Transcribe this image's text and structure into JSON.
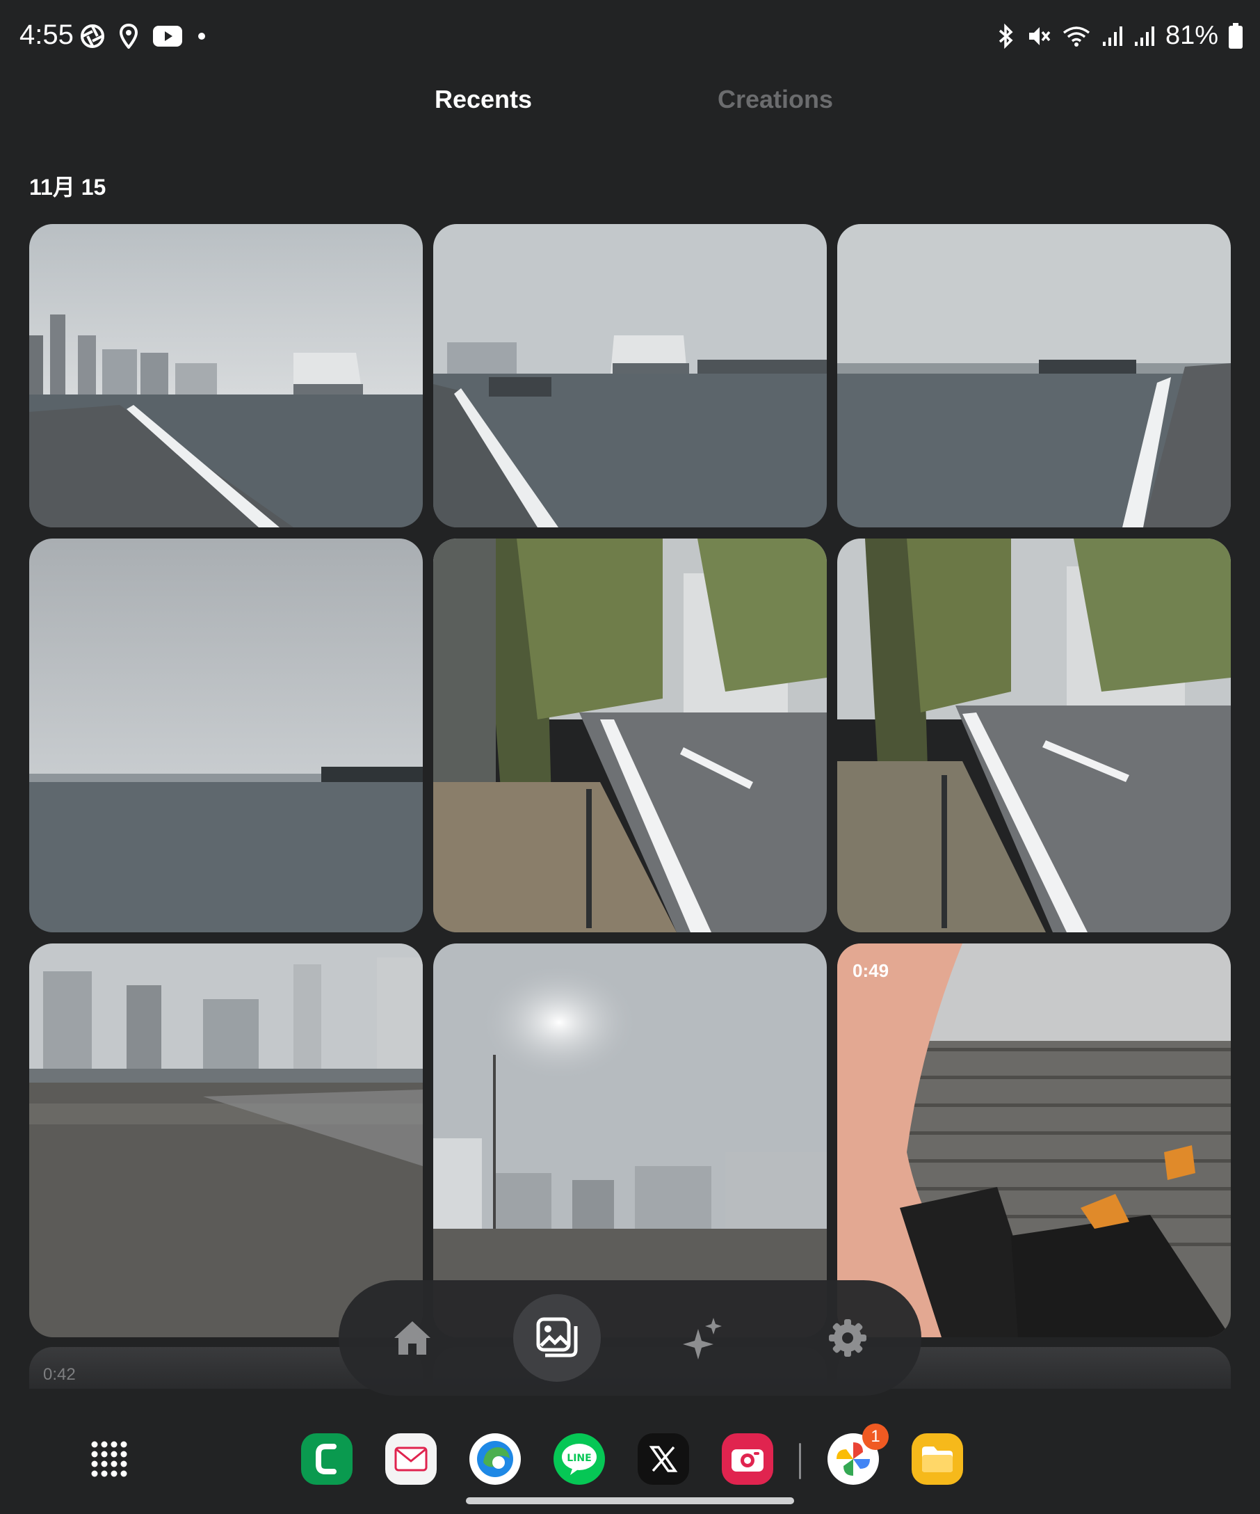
{
  "status": {
    "time": "4:55",
    "battery_pct": "81%"
  },
  "tabs": [
    {
      "label": "Recents",
      "active": true
    },
    {
      "label": "Creations",
      "active": false
    }
  ],
  "date_header": "11月 15",
  "photos": [
    {
      "kind": "photo",
      "scene": "harbor-railing-left"
    },
    {
      "kind": "photo",
      "scene": "harbor-building"
    },
    {
      "kind": "photo",
      "scene": "harbor-railing-right"
    },
    {
      "kind": "photo",
      "scene": "sea-sky"
    },
    {
      "kind": "photo",
      "scene": "street-trees"
    },
    {
      "kind": "photo",
      "scene": "street-trees-2"
    },
    {
      "kind": "photo",
      "scene": "wooden-pier"
    },
    {
      "kind": "photo",
      "scene": "pier-sun"
    },
    {
      "kind": "video",
      "scene": "deck-feet",
      "duration": "0:49"
    }
  ],
  "next_row_video_duration": "0:42",
  "bottom_nav": [
    {
      "icon": "home-icon",
      "active": false
    },
    {
      "icon": "gallery-icon",
      "active": true
    },
    {
      "icon": "sparkle-icon",
      "active": false
    },
    {
      "icon": "gear-icon",
      "active": false
    }
  ],
  "dock": {
    "apps": [
      {
        "icon": "phone-app-icon",
        "color": "#0a9a4f"
      },
      {
        "icon": "mail-app-icon",
        "color": "#f4f4f4"
      },
      {
        "icon": "edge-browser-icon",
        "color": "#ffffff"
      },
      {
        "icon": "line-app-icon",
        "color": "#06c755"
      },
      {
        "icon": "x-app-icon",
        "color": "#111111"
      },
      {
        "icon": "camera-app-icon",
        "color": "#e0244f"
      },
      {
        "icon": "google-photos-icon",
        "color": "#ffffff"
      },
      {
        "icon": "files-app-icon",
        "color": "#f6b91b"
      }
    ],
    "photos_badge": "1"
  }
}
